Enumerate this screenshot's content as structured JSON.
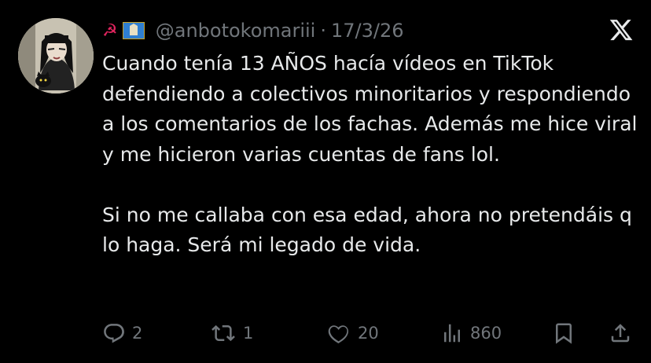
{
  "tweet": {
    "handle": "@anbotokomariii",
    "separator": "·",
    "date": "17/3/26",
    "flag_symbol": "☭",
    "paragraphs": [
      "Cuando tenía 13 AÑOS hacía vídeos en TikTok defendiendo a colectivos minoritarios y respondiendo a los comentarios de los fachas. Además me hice viral y me hicieron varias cuentas de fans lol.",
      "Si no me callaba con esa edad, ahora no pretendáis q lo haga. Será mi legado de vida."
    ]
  },
  "actions": {
    "replies": "2",
    "reposts": "1",
    "likes": "20",
    "views": "860"
  },
  "icons": {
    "reply": "reply-icon",
    "repost": "repost-icon",
    "like": "heart-icon",
    "views": "views-icon",
    "bookmark": "bookmark-icon",
    "share": "share-icon",
    "brand": "x-logo-icon"
  },
  "colors": {
    "background": "#000000",
    "text": "#e7e9ea",
    "secondary": "#71767b"
  }
}
